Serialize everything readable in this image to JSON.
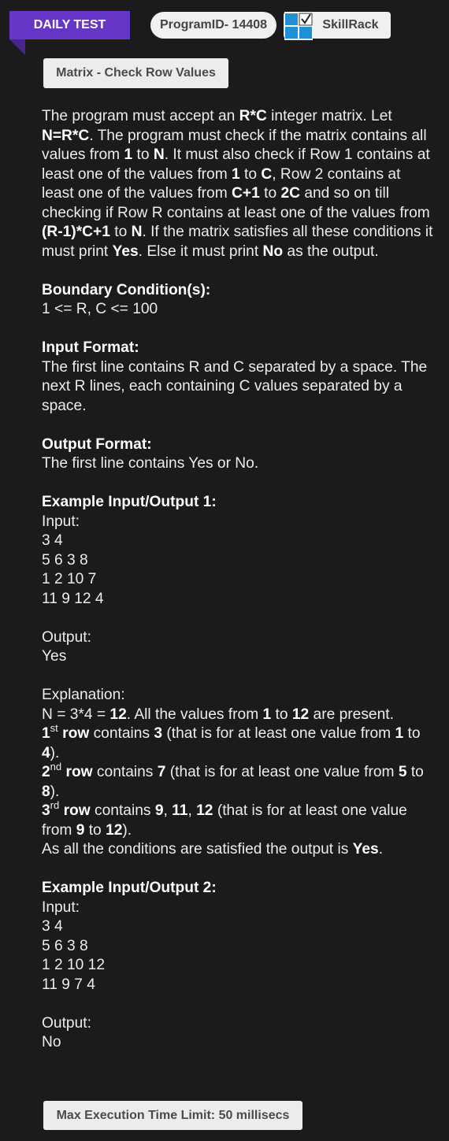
{
  "header": {
    "badge": "DAILY TEST",
    "program_id": "ProgramID- 14408",
    "brand": "SkillRack",
    "logo_icon": "skillrack-checkbox-logo"
  },
  "problem_title": "Matrix - Check Row Values",
  "description": [
    {
      "t": "The program must accept an "
    },
    {
      "b": "R*C"
    },
    {
      "t": " integer matrix. Let "
    },
    {
      "b": "N=R*C"
    },
    {
      "t": ". The program must check if the matrix contains all values from "
    },
    {
      "b": "1"
    },
    {
      "t": " to "
    },
    {
      "b": "N"
    },
    {
      "t": ". It must also check if Row 1 contains at least one of the values from "
    },
    {
      "b": "1"
    },
    {
      "t": " to "
    },
    {
      "b": "C"
    },
    {
      "t": ", Row 2 contains at least one of the values from "
    },
    {
      "b": "C+1"
    },
    {
      "t": " to "
    },
    {
      "b": "2C"
    },
    {
      "t": " and so on till checking if Row R contains at least one of the values from "
    },
    {
      "b": "(R-1)*C+1"
    },
    {
      "t": " to "
    },
    {
      "b": "N"
    },
    {
      "t": ". If the matrix satisfies all these conditions it must print "
    },
    {
      "b": "Yes"
    },
    {
      "t": ". Else it must print "
    },
    {
      "b": "No"
    },
    {
      "t": " as the output."
    }
  ],
  "boundary": {
    "heading": "Boundary Condition(s):",
    "text": "1 <= R, C <= 100"
  },
  "input_format": {
    "heading": "Input Format:",
    "text": "The first line contains R and C separated by a space. The next R lines, each containing C values separated by a space."
  },
  "output_format": {
    "heading": "Output Format:",
    "text": "The first line contains Yes or No."
  },
  "example1": {
    "heading": "Example Input/Output 1:",
    "input_label": "Input:",
    "input_lines": [
      "3 4",
      "5 6 3 8",
      "1 2 10 7",
      "11 9 12 4"
    ],
    "output_label": "Output:",
    "output": "Yes",
    "explanation_label": "Explanation:",
    "explanation": [
      [
        {
          "t": "N = 3*4 = "
        },
        {
          "b": "12"
        },
        {
          "t": ". All the values from "
        },
        {
          "b": "1"
        },
        {
          "t": " to "
        },
        {
          "b": "12"
        },
        {
          "t": " are present."
        }
      ],
      [
        {
          "b": "1"
        },
        {
          "sup": "st"
        },
        {
          "b": " row"
        },
        {
          "t": " contains "
        },
        {
          "b": "3"
        },
        {
          "t": " (that is for at least one value from "
        },
        {
          "b": "1"
        },
        {
          "t": " to "
        },
        {
          "b": "4"
        },
        {
          "t": ")."
        }
      ],
      [
        {
          "b": "2"
        },
        {
          "sup": "nd"
        },
        {
          "b": " row"
        },
        {
          "t": " contains "
        },
        {
          "b": "7"
        },
        {
          "t": " (that is for at least one value from "
        },
        {
          "b": "5"
        },
        {
          "t": " to "
        },
        {
          "b": "8"
        },
        {
          "t": ")."
        }
      ],
      [
        {
          "b": "3"
        },
        {
          "sup": "rd"
        },
        {
          "b": " row"
        },
        {
          "t": " contains "
        },
        {
          "b": "9"
        },
        {
          "t": ", "
        },
        {
          "b": "11"
        },
        {
          "t": ", "
        },
        {
          "b": "12"
        },
        {
          "t": " (that is for at least one value from "
        },
        {
          "b": "9"
        },
        {
          "t": " to "
        },
        {
          "b": "12"
        },
        {
          "t": ")."
        }
      ],
      [
        {
          "t": "As all the conditions are satisfied the output is "
        },
        {
          "b": "Yes"
        },
        {
          "t": "."
        }
      ]
    ]
  },
  "example2": {
    "heading": "Example Input/Output 2:",
    "input_label": "Input:",
    "input_lines": [
      "3 4",
      "5 6 3 8",
      "1 2 10 12",
      "11 9 7 4"
    ],
    "output_label": "Output:",
    "output": "No"
  },
  "footer": {
    "time_limit": "Max Execution Time Limit: 50 millisecs"
  },
  "colors": {
    "background": "#1b1b1b",
    "badge": "#6637c6",
    "text": "#ececec",
    "logo_blue": "#1e90d6"
  }
}
